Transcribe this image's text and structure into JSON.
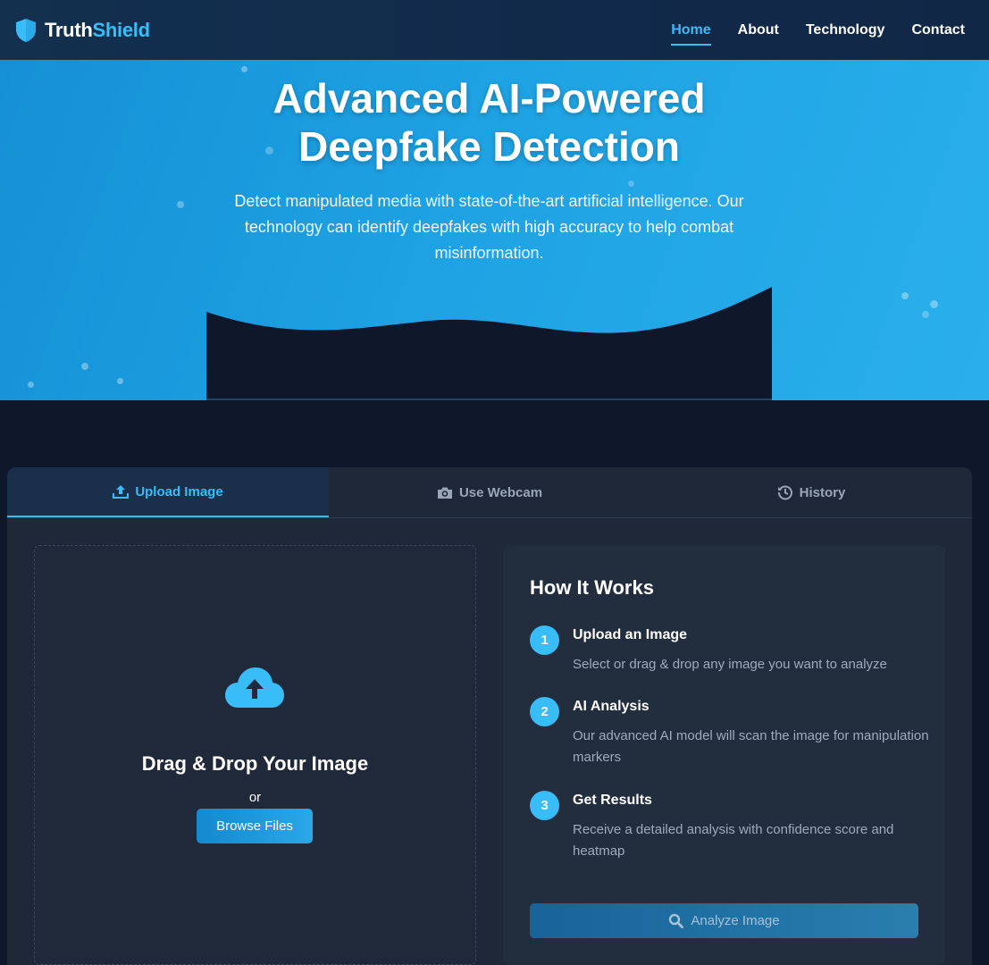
{
  "nav": {
    "brand_part1": "Truth",
    "brand_part2": "Shield",
    "brand_icon": "shield-icon",
    "links": [
      {
        "label": "Home",
        "active": true
      },
      {
        "label": "About",
        "active": false
      },
      {
        "label": "Technology",
        "active": false
      },
      {
        "label": "Contact",
        "active": false
      }
    ]
  },
  "hero": {
    "title_line1": "Advanced AI-Powered",
    "title_line2": "Deepfake Detection",
    "subtitle": "Detect manipulated media with state-of-the-art artificial intelligence. Our technology can identify deepfakes with high accuracy to help combat misinformation."
  },
  "tabs": [
    {
      "label": "Upload Image",
      "icon": "upload-icon",
      "active": true
    },
    {
      "label": "Use Webcam",
      "icon": "camera-icon",
      "active": false
    },
    {
      "label": "History",
      "icon": "history-icon",
      "active": false
    }
  ],
  "dropzone": {
    "icon": "cloud-upload-icon",
    "title": "Drag & Drop Your Image",
    "or_text": "or",
    "browse_label": "Browse Files"
  },
  "how": {
    "title": "How It Works",
    "steps": [
      {
        "num": "1",
        "title": "Upload an Image",
        "desc": "Select or drag & drop any image you want to analyze"
      },
      {
        "num": "2",
        "title": "AI Analysis",
        "desc": "Our advanced AI model will scan the image for manipulation markers"
      },
      {
        "num": "3",
        "title": "Get Results",
        "desc": "Receive a detailed analysis with confidence score and heatmap"
      }
    ],
    "analyze_label": "Analyze Image",
    "analyze_icon": "search-icon"
  },
  "colors": {
    "accent": "#38bdf8",
    "page_bg": "#0f172a",
    "card_bg": "#1e2838",
    "hero_start": "#1590d6",
    "hero_end": "#2aafec"
  }
}
